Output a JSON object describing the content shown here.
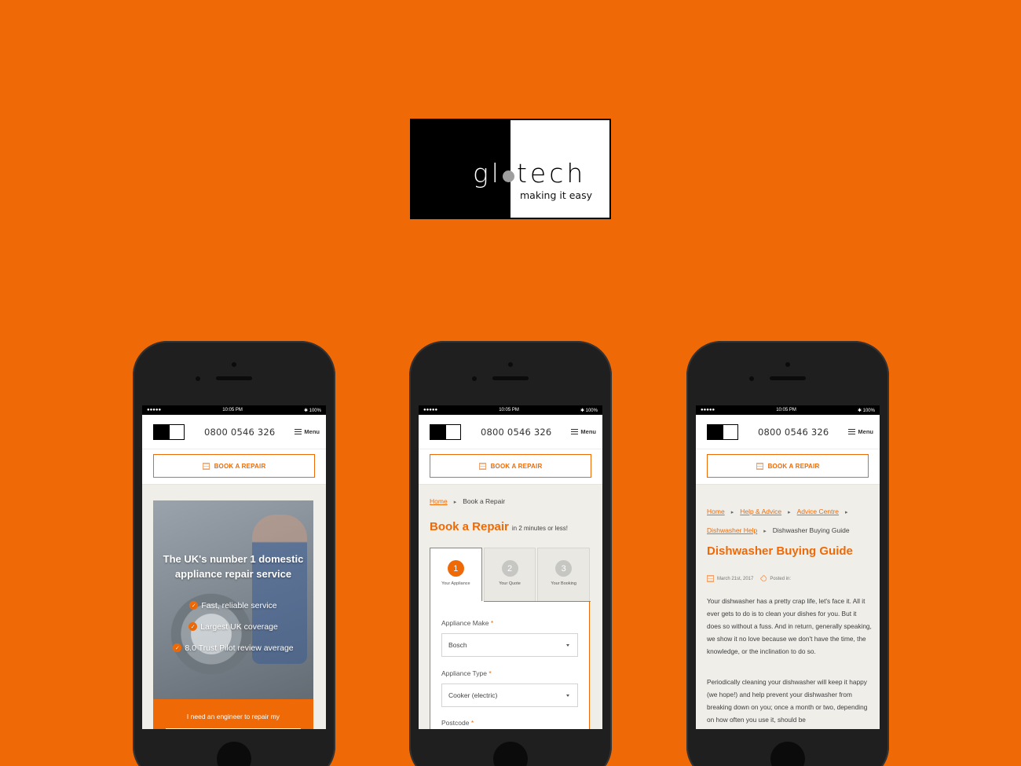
{
  "brand": {
    "logo_left": "gl",
    "logo_right": "tech",
    "tagline": "making it easy"
  },
  "status": {
    "signal": "●●●●● ",
    "time": "10:05 PM",
    "battery": "✱ 100%"
  },
  "header": {
    "phone": "0800 0546 326",
    "menu": "Menu",
    "book": "BOOK A REPAIR"
  },
  "home": {
    "hero_title": "The UK's number 1 domestic appliance repair service",
    "features": [
      "Fast, reliable service",
      "Largest UK coverage",
      "8.0 Trust Pilot review average"
    ],
    "cta": "I need an engineer to repair my"
  },
  "booking": {
    "crumb_home": "Home",
    "crumb_current": "Book a Repair",
    "title": "Book a Repair",
    "subtitle": "in 2 minutes or less!",
    "steps": [
      {
        "num": "1",
        "label": "Your Appliance"
      },
      {
        "num": "2",
        "label": "Your Quote"
      },
      {
        "num": "3",
        "label": "Your Booking"
      }
    ],
    "make_label": "Appliance Make",
    "make_value": "Bosch",
    "type_label": "Appliance Type",
    "type_value": "Cooker (electric)",
    "postcode_label": "Postcode",
    "required_mark": "*"
  },
  "article": {
    "crumbs": [
      "Home",
      "Help & Advice",
      "Advice Centre",
      "Dishwasher Help"
    ],
    "crumb_current": "Dishwasher Buying Guide",
    "title": "Dishwasher Buying Guide",
    "date": "March 21st, 2017",
    "posted_in": "Posted in:",
    "para1": "Your dishwasher has a pretty crap life, let's face it. All it ever gets to do is to clean your dishes for you. But it does so without a fuss. And in return, generally speaking, we show it no love because we don't have the time, the knowledge, or the inclination to do so.",
    "para2": "Periodically cleaning your dishwasher will keep it happy (we hope!) and help prevent your dishwasher from breaking down on you; once a month or two, depending on how often you use it, should be"
  },
  "colors": {
    "accent": "#ef6a06",
    "background": "#ef6a06",
    "phone": "#1f1f1f"
  }
}
